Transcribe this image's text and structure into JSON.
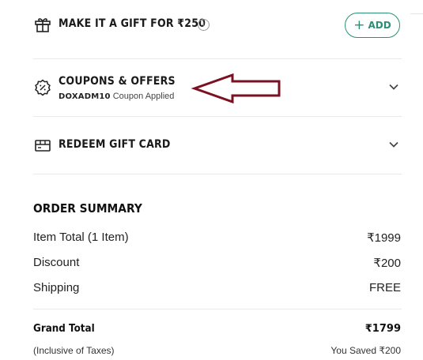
{
  "gift": {
    "title": "MAKE IT A GIFT FOR ₹250",
    "info_glyph": "i",
    "add_label": "ADD",
    "add_plus": "+"
  },
  "coupons": {
    "title": "COUPONS & OFFERS",
    "code": "DOXADM10",
    "status": "Coupon Applied"
  },
  "gift_card": {
    "title": "REDEEM GIFT CARD"
  },
  "summary": {
    "title": "ORDER SUMMARY",
    "lines": [
      {
        "label": "Item Total (1 Item)",
        "value": "₹1999"
      },
      {
        "label": "Discount",
        "value": "₹200"
      },
      {
        "label": "Shipping",
        "value": "FREE"
      }
    ],
    "grand_total_label": "Grand Total",
    "grand_total_value": "₹1799",
    "tax_note": "(Inclusive of Taxes)",
    "saved": "You Saved ₹200"
  },
  "colors": {
    "accent": "#2a8f74",
    "annotation_arrow": "#7a1020"
  }
}
